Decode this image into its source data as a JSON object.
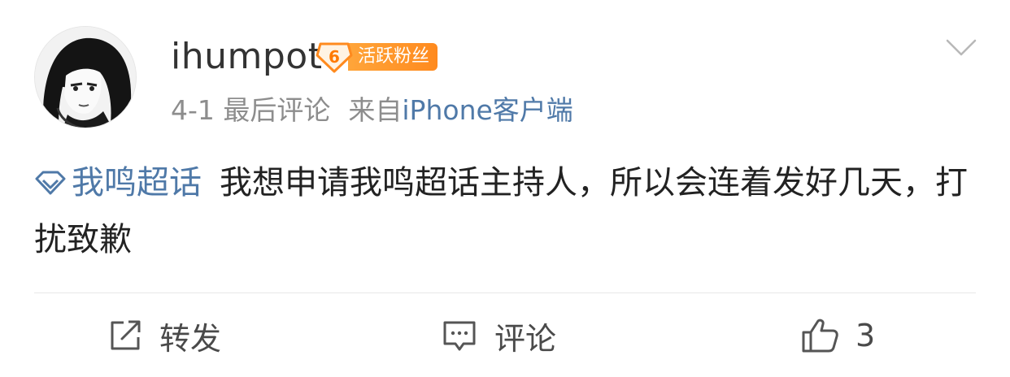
{
  "post": {
    "username": "ihumpot",
    "fan_badge": {
      "level": "6",
      "label": "活跃粉丝",
      "color": "#ff8a1e"
    },
    "meta": {
      "time": "4-1 最后评论",
      "source_prefix": "来自",
      "source_client": "iPhone客户端"
    },
    "content": {
      "topic": "我鸣超话",
      "text": "我想申请我鸣超话主持人，所以会连着发好几天，打扰致歉"
    }
  },
  "actions": {
    "repost_label": "转发",
    "comment_label": "评论",
    "like_count": "3"
  },
  "colors": {
    "link": "#4f79a8",
    "text": "#222222",
    "meta": "#8d8d8d",
    "badge": "#ff8a1e"
  },
  "icons": {
    "repost": "repost-icon",
    "comment": "comment-icon",
    "like": "thumbs-up-icon",
    "topic": "super-topic-diamond-icon",
    "more": "chevron-down-icon"
  }
}
